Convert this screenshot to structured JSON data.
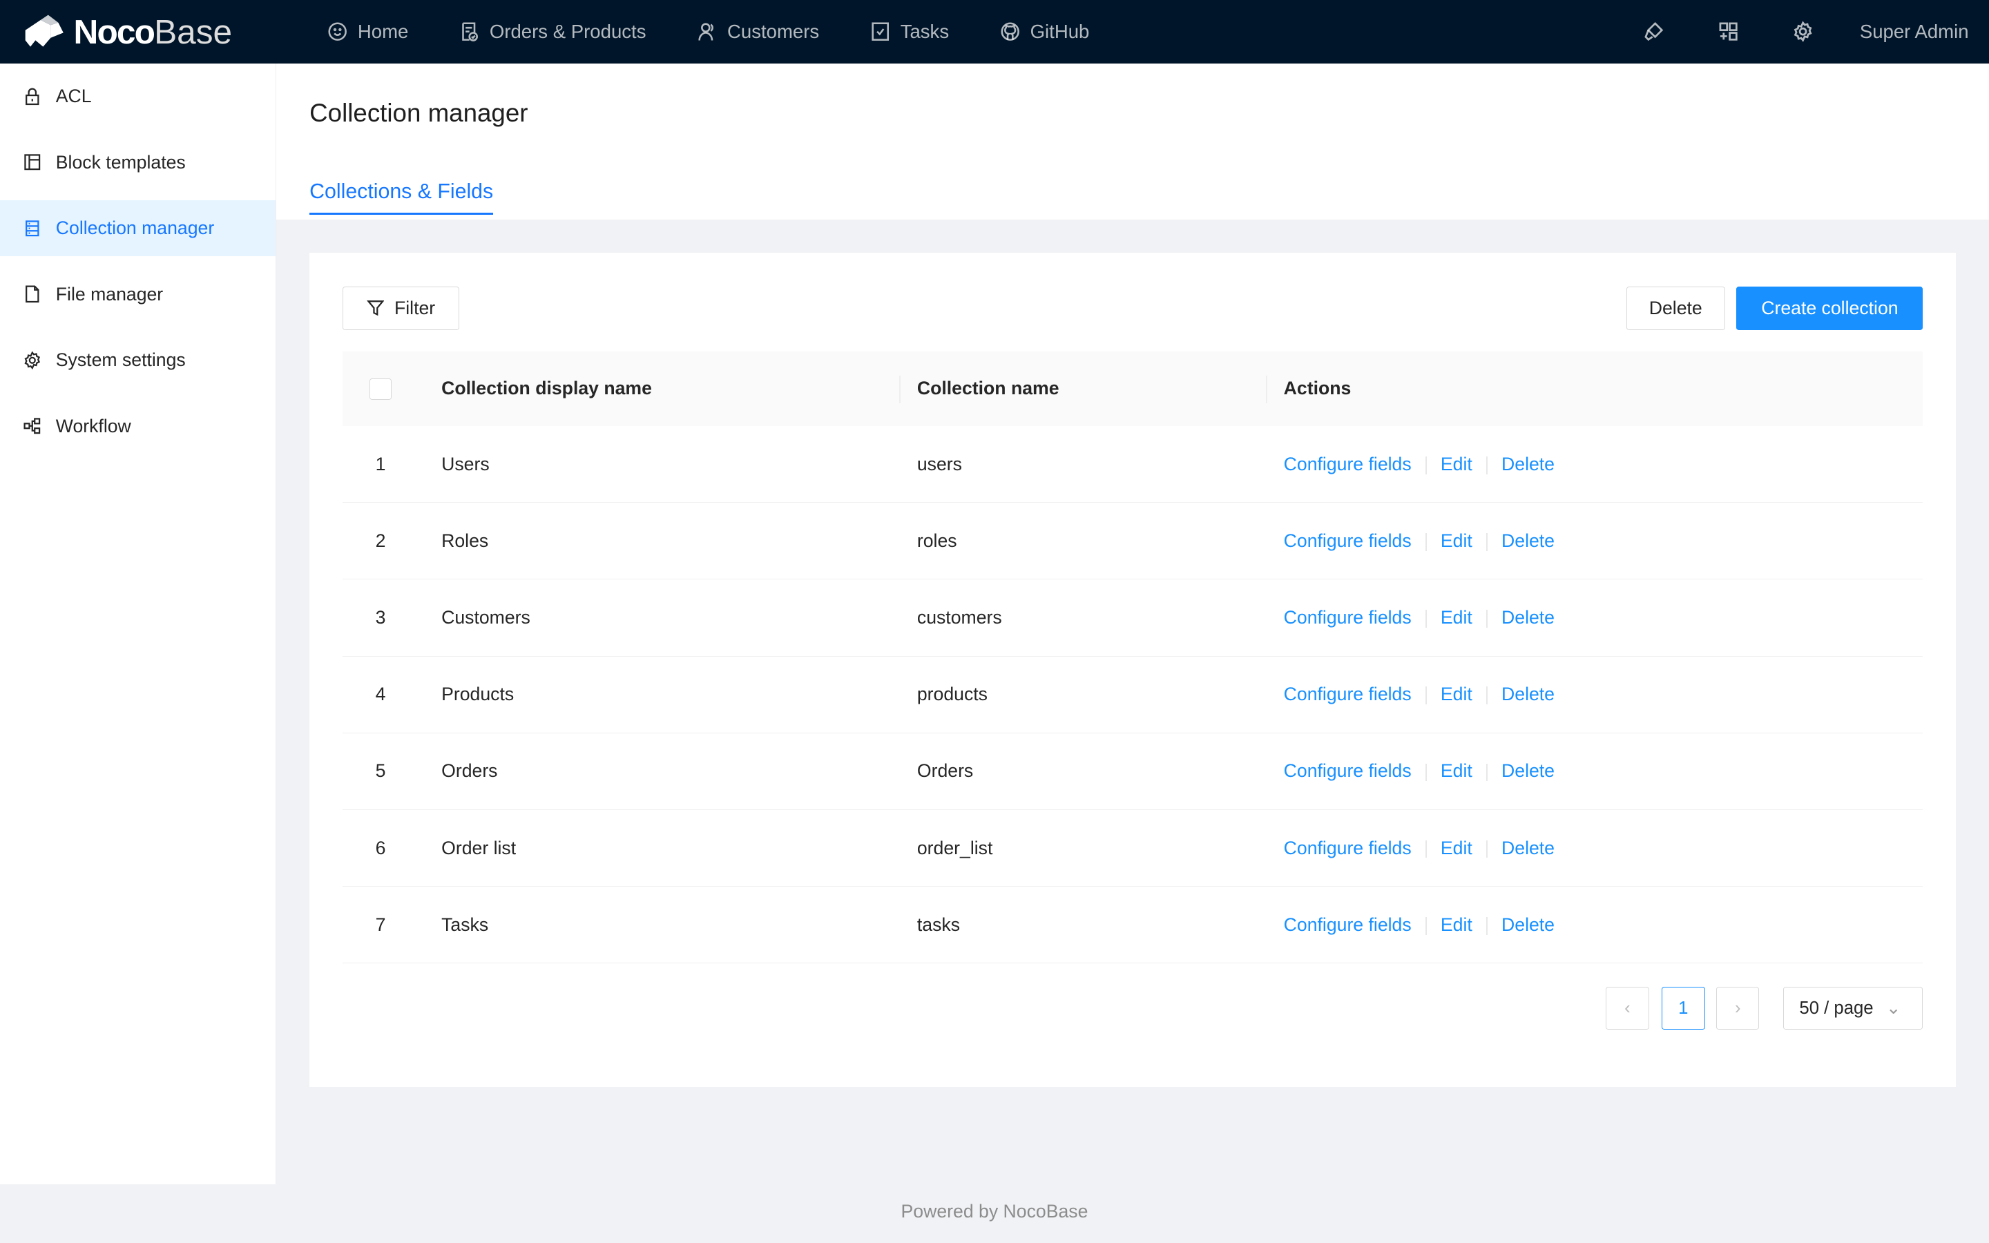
{
  "header": {
    "brand_bold": "Noco",
    "brand_light": "Base",
    "nav": [
      {
        "label": "Home",
        "icon": "smile-icon"
      },
      {
        "label": "Orders & Products",
        "icon": "file-check-icon"
      },
      {
        "label": "Customers",
        "icon": "users-icon"
      },
      {
        "label": "Tasks",
        "icon": "checkbox-icon"
      },
      {
        "label": "GitHub",
        "icon": "github-icon"
      }
    ],
    "user": "Super Admin"
  },
  "sidebar": {
    "items": [
      {
        "label": "ACL"
      },
      {
        "label": "Block templates"
      },
      {
        "label": "Collection manager",
        "active": true
      },
      {
        "label": "File manager"
      },
      {
        "label": "System settings"
      },
      {
        "label": "Workflow"
      }
    ]
  },
  "page": {
    "title": "Collection manager",
    "tab": "Collections & Fields"
  },
  "toolbar": {
    "filter": "Filter",
    "delete": "Delete",
    "create": "Create collection"
  },
  "table": {
    "headers": [
      "Collection display name",
      "Collection name",
      "Actions"
    ],
    "rows": [
      {
        "n": "1",
        "display": "Users",
        "name": "users"
      },
      {
        "n": "2",
        "display": "Roles",
        "name": "roles"
      },
      {
        "n": "3",
        "display": "Customers",
        "name": "customers"
      },
      {
        "n": "4",
        "display": "Products",
        "name": "products"
      },
      {
        "n": "5",
        "display": "Orders",
        "name": "Orders"
      },
      {
        "n": "6",
        "display": "Order list",
        "name": "order_list"
      },
      {
        "n": "7",
        "display": "Tasks",
        "name": "tasks"
      }
    ],
    "actions": {
      "configure": "Configure fields",
      "edit": "Edit",
      "delete": "Delete"
    }
  },
  "pagination": {
    "current": "1",
    "page_size": "50 / page"
  },
  "footer": "Powered by NocoBase",
  "colors": {
    "header_bg": "#001529",
    "primary": "#1890ff"
  }
}
